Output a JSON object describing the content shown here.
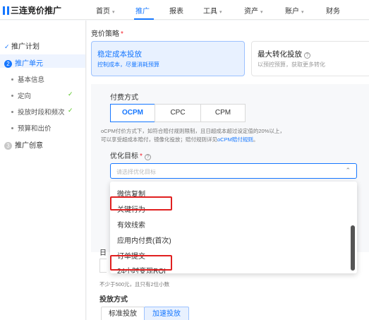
{
  "brand": {
    "name": "三连竞价推广"
  },
  "nav": {
    "items": [
      {
        "label": "首页",
        "caret": true
      },
      {
        "label": "推广",
        "caret": false,
        "active": true
      },
      {
        "label": "报表",
        "caret": false
      },
      {
        "label": "工具",
        "caret": true
      },
      {
        "label": "资产",
        "caret": true
      },
      {
        "label": "账户",
        "caret": true
      },
      {
        "label": "财务",
        "caret": false
      }
    ]
  },
  "sidebar": {
    "steps": [
      {
        "label": "推广计划",
        "state": "done"
      },
      {
        "label": "推广单元",
        "state": "active",
        "number": "2"
      },
      {
        "label": "推广创意",
        "state": "todo",
        "number": "3"
      }
    ],
    "substeps": [
      {
        "label": "基本信息",
        "checked": false
      },
      {
        "label": "定向",
        "checked": true
      },
      {
        "label": "投放时段和频次",
        "checked": true
      },
      {
        "label": "预算和出价",
        "checked": false
      }
    ]
  },
  "form": {
    "strategy_label": "竞价策略",
    "strategies": [
      {
        "title": "稳定成本投放",
        "desc": "控制成本，尽量消耗预算",
        "selected": true
      },
      {
        "title": "最大转化投放",
        "desc": "以预控预算，获取更多转化",
        "selected": false
      }
    ],
    "pay_label": "付费方式",
    "pay_options": [
      {
        "label": "OCPM",
        "active": true
      },
      {
        "label": "CPC",
        "active": false
      },
      {
        "label": "CPM",
        "active": false
      }
    ],
    "pay_note_line1": "oCPM付价方式下，如符合赔付规则限制，且日超成本超过设定值的20%以上，",
    "pay_note_line2_prefix": "可以享受超成本赔付，镜像化投放；赔付规则详见",
    "pay_note_link": "oCPM赔付规则",
    "pay_note_suffix": "。",
    "goal_label": "优化目标",
    "goal_placeholder": "请选择优化目标",
    "goal_options": [
      "微信复制",
      "关键行为",
      "有效线索",
      "应用内付费(首次)",
      "订单提交",
      "24小时变现ROI"
    ],
    "highlighted_options": [
      "关键行为",
      "24小时变现ROI"
    ],
    "budget_label_partial": "日",
    "budget_note": "不少于500元，且只有2位小数",
    "delivery_label": "投放方式",
    "delivery_options": [
      {
        "label": "标准投放",
        "active": false
      },
      {
        "label": "加速投放",
        "active": true
      }
    ]
  },
  "colors": {
    "accent": "#1677ff",
    "highlight": "#e02020",
    "check": "#52c41a"
  }
}
